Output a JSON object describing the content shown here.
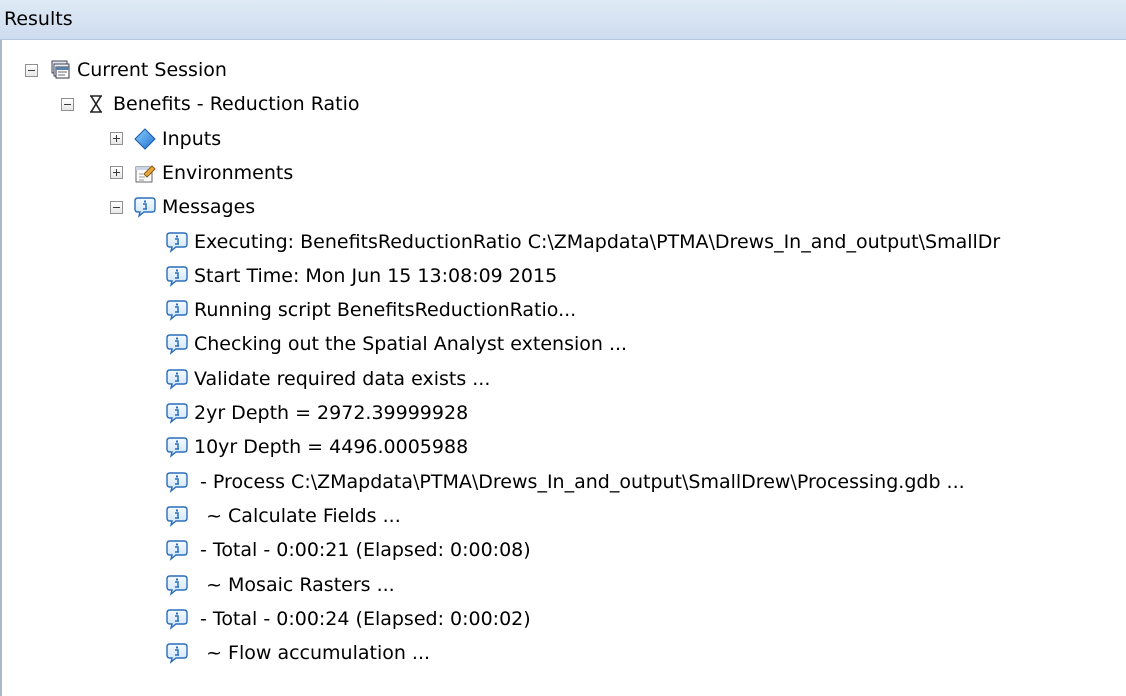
{
  "panel": {
    "title": "Results"
  },
  "tree": {
    "session": {
      "label": "Current Session",
      "expanded": true,
      "icon": "session-icon"
    },
    "tool": {
      "label": "Benefits - Reduction Ratio",
      "expanded": true,
      "icon": "hourglass-icon"
    },
    "children": [
      {
        "label": "Inputs",
        "expanded": false,
        "icon": "inputs-diamond-icon"
      },
      {
        "label": "Environments",
        "expanded": false,
        "icon": "environments-icon"
      },
      {
        "label": "Messages",
        "expanded": true,
        "icon": "info-message-icon"
      }
    ],
    "messages": [
      "Executing: BenefitsReductionRatio C:\\ZMapdata\\PTMA\\Drews_In_and_output\\SmallDr",
      "Start Time: Mon Jun 15 13:08:09 2015",
      "Running script BenefitsReductionRatio...",
      "Checking out the Spatial Analyst extension ...",
      "Validate required data exists ...",
      "2yr Depth = 2972.39999928",
      "10yr Depth = 4496.0005988",
      " - Process C:\\ZMapdata\\PTMA\\Drews_In_and_output\\SmallDrew\\Processing.gdb ...",
      "  ~ Calculate Fields ...",
      " - Total - 0:00:21 (Elapsed: 0:00:08)",
      "  ~ Mosaic Rasters ...",
      " - Total - 0:00:24 (Elapsed: 0:00:02)",
      "  ~ Flow accumulation ..."
    ]
  },
  "colors": {
    "header_bg": "#d6e2f2",
    "info_icon_blue": "#2a6ebb",
    "diamond_blue": "#2f8be0"
  }
}
